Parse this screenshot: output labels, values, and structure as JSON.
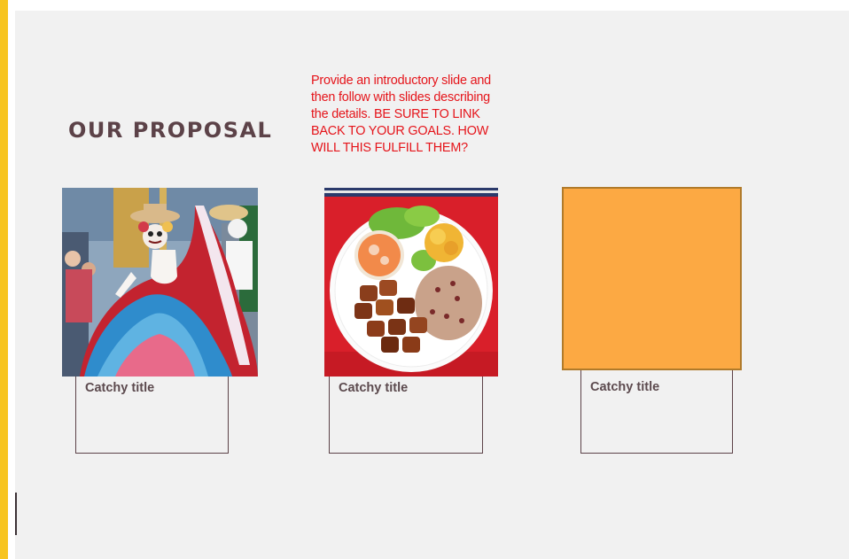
{
  "colors": {
    "accent": "#f7c41f",
    "slide_background": "#f1f1f1",
    "title_text": "#5c4248",
    "note_text": "#e5141a",
    "orange_card": "#fca943",
    "caption_border": "#5c4248"
  },
  "slide": {
    "title": "OUR PROPOSAL",
    "instruction_note": "Provide an introductory slide and then follow with slides describing the details. BE SURE TO LINK BACK TO YOUR GOALS. HOW WILL THIS FULFILL THEM?",
    "cards": [
      {
        "image": "folklorico-dancer-photo",
        "caption": "Catchy title"
      },
      {
        "image": "plated-meal-photo",
        "caption": "Catchy title"
      },
      {
        "image": "orange-placeholder-square",
        "caption": "Catchy title"
      }
    ]
  }
}
